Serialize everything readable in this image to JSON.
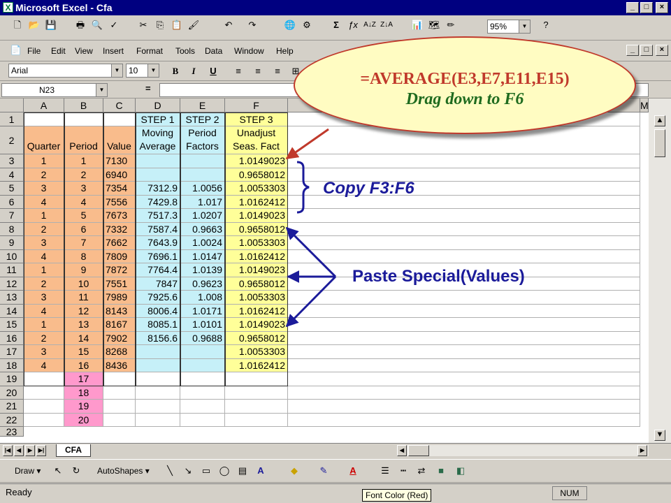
{
  "window": {
    "title": "Microsoft Excel - Cfa",
    "min": "_",
    "max": "□",
    "close": "×"
  },
  "toolbar": {
    "zoom": "95%"
  },
  "menu": {
    "items": [
      "File",
      "Edit",
      "View",
      "Insert",
      "Format",
      "Tools",
      "Data",
      "Window",
      "Help"
    ]
  },
  "format": {
    "font": "Arial",
    "size": "10",
    "bold": "B",
    "italic": "I",
    "underline": "U"
  },
  "formula_bar": {
    "name_box": "N23",
    "eq": "="
  },
  "columns": [
    "A",
    "B",
    "C",
    "D",
    "E",
    "F",
    "M"
  ],
  "row_numbers": [
    "1",
    "2",
    "3",
    "4",
    "5",
    "6",
    "7",
    "8",
    "9",
    "10",
    "11",
    "12",
    "13",
    "14",
    "15",
    "16",
    "17",
    "18",
    "19",
    "20",
    "21",
    "22",
    "23"
  ],
  "headers": {
    "D1": "STEP 1",
    "E1": "STEP 2",
    "F1": "STEP 3",
    "A2": "Quarter",
    "B2": "Period",
    "C2": "Value",
    "D2a": "Moving",
    "D2b": "Average",
    "E2a": "Period",
    "E2b": "Factors",
    "F2a": "Unadjust",
    "F2b": "Seas. Fact"
  },
  "rows": [
    {
      "a": "1",
      "b": "1",
      "c": "7130",
      "d": "",
      "e": "",
      "f": "1.0149023"
    },
    {
      "a": "2",
      "b": "2",
      "c": "6940",
      "d": "",
      "e": "",
      "f": "0.9658012"
    },
    {
      "a": "3",
      "b": "3",
      "c": "7354",
      "d": "7312.9",
      "e": "1.0056",
      "f": "1.0053303"
    },
    {
      "a": "4",
      "b": "4",
      "c": "7556",
      "d": "7429.8",
      "e": "1.017",
      "f": "1.0162412"
    },
    {
      "a": "1",
      "b": "5",
      "c": "7673",
      "d": "7517.3",
      "e": "1.0207",
      "f": "1.0149023"
    },
    {
      "a": "2",
      "b": "6",
      "c": "7332",
      "d": "7587.4",
      "e": "0.9663",
      "f": "0.9658012"
    },
    {
      "a": "3",
      "b": "7",
      "c": "7662",
      "d": "7643.9",
      "e": "1.0024",
      "f": "1.0053303"
    },
    {
      "a": "4",
      "b": "8",
      "c": "7809",
      "d": "7696.1",
      "e": "1.0147",
      "f": "1.0162412"
    },
    {
      "a": "1",
      "b": "9",
      "c": "7872",
      "d": "7764.4",
      "e": "1.0139",
      "f": "1.0149023"
    },
    {
      "a": "2",
      "b": "10",
      "c": "7551",
      "d": "7847",
      "e": "0.9623",
      "f": "0.9658012"
    },
    {
      "a": "3",
      "b": "11",
      "c": "7989",
      "d": "7925.6",
      "e": "1.008",
      "f": "1.0053303"
    },
    {
      "a": "4",
      "b": "12",
      "c": "8143",
      "d": "8006.4",
      "e": "1.0171",
      "f": "1.0162412"
    },
    {
      "a": "1",
      "b": "13",
      "c": "8167",
      "d": "8085.1",
      "e": "1.0101",
      "f": "1.0149023"
    },
    {
      "a": "2",
      "b": "14",
      "c": "7902",
      "d": "8156.6",
      "e": "0.9688",
      "f": "0.9658012"
    },
    {
      "a": "3",
      "b": "15",
      "c": "8268",
      "d": "",
      "e": "",
      "f": "1.0053303"
    },
    {
      "a": "4",
      "b": "16",
      "c": "8436",
      "d": "",
      "e": "",
      "f": "1.0162412"
    },
    {
      "a": "",
      "b": "17",
      "c": "",
      "d": "",
      "e": "",
      "f": ""
    },
    {
      "a": "",
      "b": "18",
      "c": "",
      "d": "",
      "e": "",
      "f": ""
    },
    {
      "a": "",
      "b": "19",
      "c": "",
      "d": "",
      "e": "",
      "f": ""
    },
    {
      "a": "",
      "b": "20",
      "c": "",
      "d": "",
      "e": "",
      "f": ""
    }
  ],
  "callouts": {
    "formula": "=AVERAGE(E3,E7,E11,E15)",
    "drag": "Drag down to F6",
    "copy": "Copy F3:F6",
    "paste": "Paste Special(Values)"
  },
  "sheet_tab": "CFA",
  "drawing": {
    "draw": "Draw",
    "autoshapes": "AutoShapes"
  },
  "status": {
    "left": "Ready",
    "num": "NUM",
    "tooltip": "Font Color (Red)"
  },
  "colors": {
    "orange": "#f9bc8c",
    "blue": "#c6f0f8",
    "yellow": "#ffff99",
    "pink": "#ff99cc",
    "annotation": "#1b1b9a",
    "balloon_text": "#1f6b1f"
  }
}
